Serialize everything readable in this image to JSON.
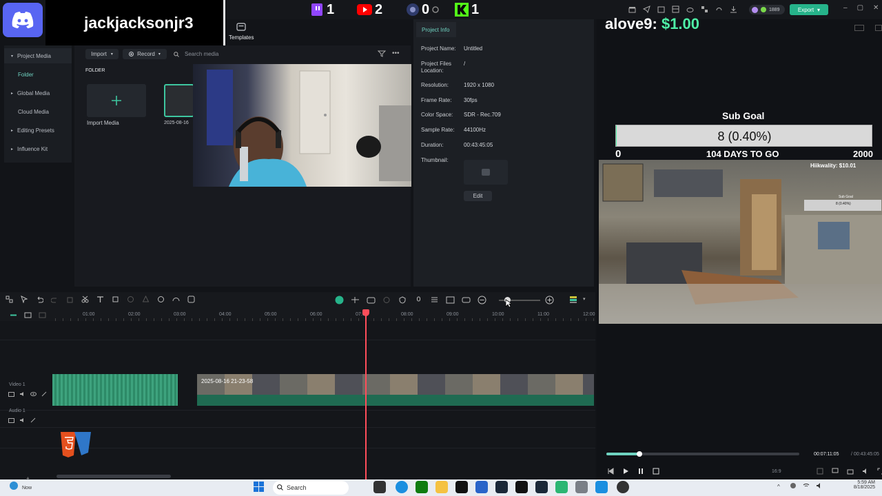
{
  "streamer": {
    "name": "jackjacksonjr3",
    "platforms": [
      {
        "name": "twitch-icon",
        "count": "1",
        "color": "#9146ff"
      },
      {
        "name": "youtube-icon",
        "count": "2",
        "color": "#ff0000"
      },
      {
        "name": "tiktok-icon",
        "count": "0",
        "color": "#2f3b6b"
      },
      {
        "name": "kick-icon",
        "count": "1",
        "color": "#53fc18"
      }
    ]
  },
  "topbar": {
    "templates_label": "Templates",
    "credits": "1889",
    "export_label": "Export"
  },
  "nav": {
    "items": [
      "Project Media",
      "Folder",
      "Global Media",
      "Cloud Media",
      "Editing Presets",
      "Influence Kit"
    ]
  },
  "media": {
    "import_label": "Import",
    "record_label": "Record",
    "search_placeholder": "Search media",
    "folder_heading": "FOLDER",
    "import_media_label": "Import Media",
    "clip_label": "2025-08-16"
  },
  "project_info": {
    "tab_label": "Project Info",
    "rows": [
      {
        "label": "Project Name:",
        "value": "Untitled"
      },
      {
        "label": "Project Files Location:",
        "value": "/"
      },
      {
        "label": "Resolution:",
        "value": "1920 x 1080"
      },
      {
        "label": "Frame Rate:",
        "value": "30fps"
      },
      {
        "label": "Color Space:",
        "value": "SDR - Rec.709"
      },
      {
        "label": "Sample Rate:",
        "value": "44100Hz"
      },
      {
        "label": "Duration:",
        "value": "00:43:45:05"
      },
      {
        "label": "Thumbnail:",
        "value": ""
      }
    ],
    "edit_label": "Edit"
  },
  "overlay": {
    "donor": "alove9:",
    "donation": "$1.00",
    "subgoal_title": "Sub Goal",
    "subgoal_value": "8 (0.40%)",
    "subgoal_progress": 0.004,
    "subgoal_min": "0",
    "subgoal_days": "104 DAYS TO GO",
    "subgoal_max": "2000",
    "game_donor": "Hiikwality: $10.01",
    "game_goal_title": "Sub Goal",
    "game_goal_value": "8 (0.40%)"
  },
  "timeline": {
    "ticks": [
      "01:00",
      "02:00",
      "03:00",
      "04:00",
      "05:00",
      "06:00",
      "07:00",
      "08:00",
      "09:00",
      "10:00",
      "11:00",
      "12:00"
    ],
    "video_track_label": "Video 1",
    "audio_track_label": "Audio 1",
    "clip_label": "2025-08-16 21-23-58"
  },
  "player": {
    "current_time": "00:07:11:05",
    "total_time": "/ 00:43:45:05",
    "aspect": "16:9",
    "progress": 0.17
  },
  "taskbar": {
    "weather_label": "Now",
    "search_placeholder": "Search",
    "time": "5:59 AM",
    "date": "8/18/2025"
  }
}
